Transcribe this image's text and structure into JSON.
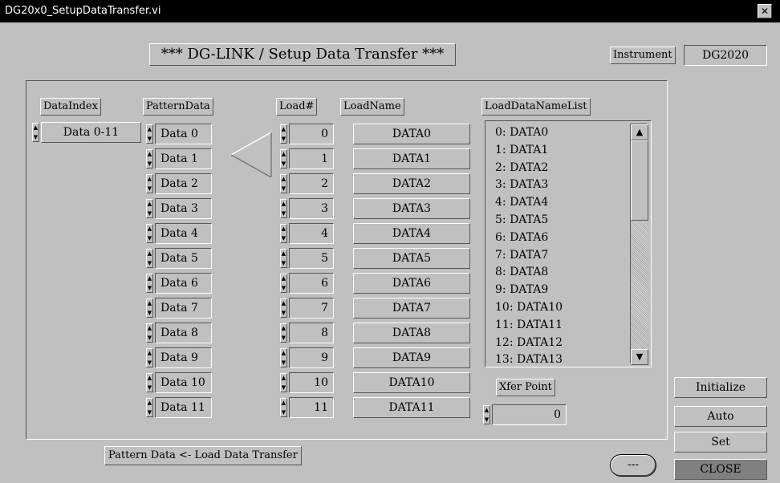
{
  "window": {
    "title": "DG20x0_SetupDataTransfer.vi",
    "close_glyph": "✕"
  },
  "header": {
    "title": "*** DG-LINK / Setup Data Transfer ***",
    "instrument_label": "Instrument",
    "instrument_value": "DG2020"
  },
  "columns": {
    "data_index": "DataIndex",
    "pattern_data": "PatternData",
    "load_num": "Load#",
    "load_name": "LoadName",
    "load_data_name_list": "LoadDataNameList"
  },
  "data_index_value": "Data 0-11",
  "pattern_data": [
    "Data 0",
    "Data 1",
    "Data 2",
    "Data 3",
    "Data 4",
    "Data 5",
    "Data 6",
    "Data 7",
    "Data 8",
    "Data 9",
    "Data 10",
    "Data 11"
  ],
  "load_nums": [
    "0",
    "1",
    "2",
    "3",
    "4",
    "5",
    "6",
    "7",
    "8",
    "9",
    "10",
    "11"
  ],
  "load_names": [
    "DATA0",
    "DATA1",
    "DATA2",
    "DATA3",
    "DATA4",
    "DATA5",
    "DATA6",
    "DATA7",
    "DATA8",
    "DATA9",
    "DATA10",
    "DATA11"
  ],
  "load_data_name_list": [
    "0:  DATA0",
    "1:  DATA1",
    "2:  DATA2",
    "3:  DATA3",
    "4:  DATA4",
    "5:  DATA5",
    "6:  DATA6",
    "7:  DATA7",
    "8:  DATA8",
    "9:  DATA9",
    "10:  DATA10",
    "11:  DATA11",
    "12:  DATA12",
    "13:  DATA13"
  ],
  "scrollbar": {
    "up_glyph": "▲",
    "down_glyph": "▼"
  },
  "spin": {
    "up": "▲",
    "down": "▼"
  },
  "xfer_point": {
    "label": "Xfer Point",
    "value": "0"
  },
  "buttons": {
    "initialize": "Initialize",
    "auto": "Auto",
    "set": "Set",
    "close": "CLOSE",
    "transfer": "Pattern Data <- Load Data Transfer",
    "ellipsis": "---"
  },
  "colors": {
    "background": "#c0c0c0",
    "titlebar": "#000000",
    "close_button": "#808080"
  }
}
